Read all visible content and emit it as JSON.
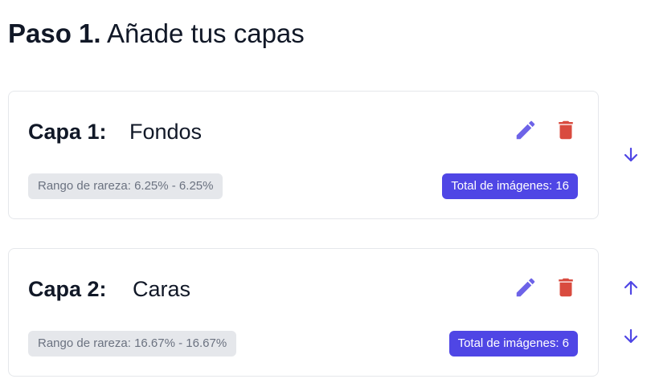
{
  "header": {
    "step_label": "Paso 1.",
    "title": "Añade tus capas"
  },
  "layers": [
    {
      "label": "Capa 1:",
      "name": "Fondos",
      "rarity": "Rango de rareza: 6.25% - 6.25%",
      "total": "Total de imágenes: 16"
    },
    {
      "label": "Capa 2:",
      "name": "Caras",
      "rarity": "Rango de rareza: 16.67% - 16.67%",
      "total": "Total de imágenes: 6"
    }
  ],
  "icons": {
    "edit": "pencil-icon",
    "delete": "trash-icon",
    "move_up": "arrow-up-icon",
    "move_down": "arrow-down-icon"
  },
  "colors": {
    "accent": "#4f46e5",
    "edit_icon": "#6d63e8",
    "delete_icon": "#d94b3f",
    "badge_gray": "#e5e7eb",
    "border": "#e5e7eb"
  }
}
